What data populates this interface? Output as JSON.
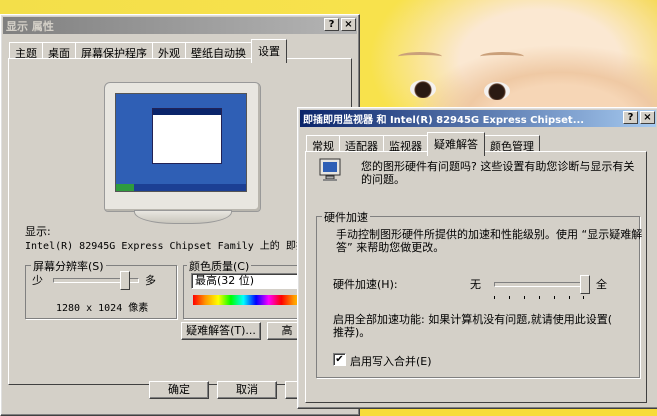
{
  "display_props": {
    "title": "显示 属性",
    "help_btn": "?",
    "close_btn": "×",
    "tabs": [
      "主题",
      "桌面",
      "屏幕保护程序",
      "外观",
      "壁纸自动换",
      "设置"
    ],
    "display_label": "显示:",
    "display_value": "Intel(R) 82945G Express Chipset Family 上的 即插即用",
    "resolution_group": "屏幕分辨率(S)",
    "less": "少",
    "more": "多",
    "resolution_value": "1280 x 1024 像素",
    "color_group": "颜色质量(C)",
    "color_value": "最高(32 位)",
    "troubleshoot_btn": "疑难解答(T)...",
    "advanced_btn_partial": "高",
    "ok_btn": "确定",
    "cancel_btn": "取消",
    "resolution_level": 0.85
  },
  "adapter_props": {
    "title": "即插即用监视器 和 Intel(R) 82945G Express Chipset...",
    "help_btn": "?",
    "close_btn": "×",
    "tabs": [
      "常规",
      "适配器",
      "监视器",
      "疑难解答",
      "颜色管理"
    ],
    "intro_text_1": "您的图形硬件有问题吗? 这些设置有助您诊断与显示有关",
    "intro_text_2": "的问题。",
    "hw_group": "硬件加速",
    "hw_desc_1": "手动控制图形硬件所提供的加速和性能级别。使用 “显示疑难解",
    "hw_desc_2": "答” 来帮助您做更改。",
    "hw_accel_label": "硬件加速(H):",
    "none": "无",
    "full": "全",
    "hw_level": 1.0,
    "enable_text_1": "启用全部加速功能: 如果计算机没有问题,就请使用此设置(",
    "enable_text_2": "推荐)。",
    "write_combine_label": "启用写入合并(E)",
    "write_combine_checked": "✔"
  }
}
